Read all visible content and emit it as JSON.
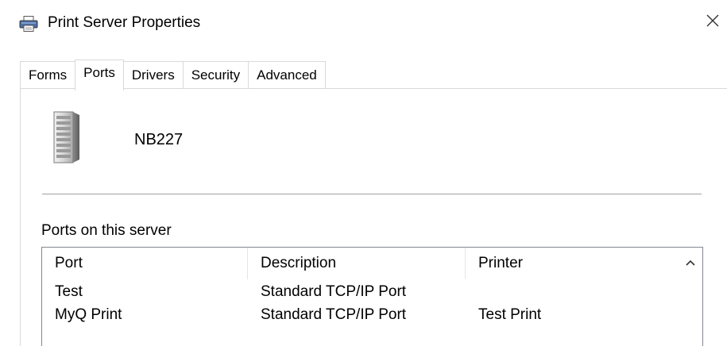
{
  "window": {
    "title": "Print Server Properties",
    "title_icon": "printer-icon",
    "close_icon": "close-icon"
  },
  "tabs": [
    {
      "label": "Forms",
      "active": false
    },
    {
      "label": "Ports",
      "active": true
    },
    {
      "label": "Drivers",
      "active": false
    },
    {
      "label": "Security",
      "active": false
    },
    {
      "label": "Advanced",
      "active": false
    }
  ],
  "server": {
    "icon": "server-tower-icon",
    "name": "NB227"
  },
  "ports": {
    "label": "Ports on this server",
    "columns": [
      "Port",
      "Description",
      "Printer"
    ],
    "rows": [
      {
        "port": "Test",
        "description": "Standard TCP/IP Port",
        "printer": ""
      },
      {
        "port": "MyQ Print",
        "description": "Standard TCP/IP Port",
        "printer": "Test Print"
      }
    ],
    "scroll_icon": "chevron-up-icon"
  },
  "colors": {
    "border": "#d9d9d9",
    "divider": "#a0a0a0",
    "listview_border": "#828790"
  }
}
